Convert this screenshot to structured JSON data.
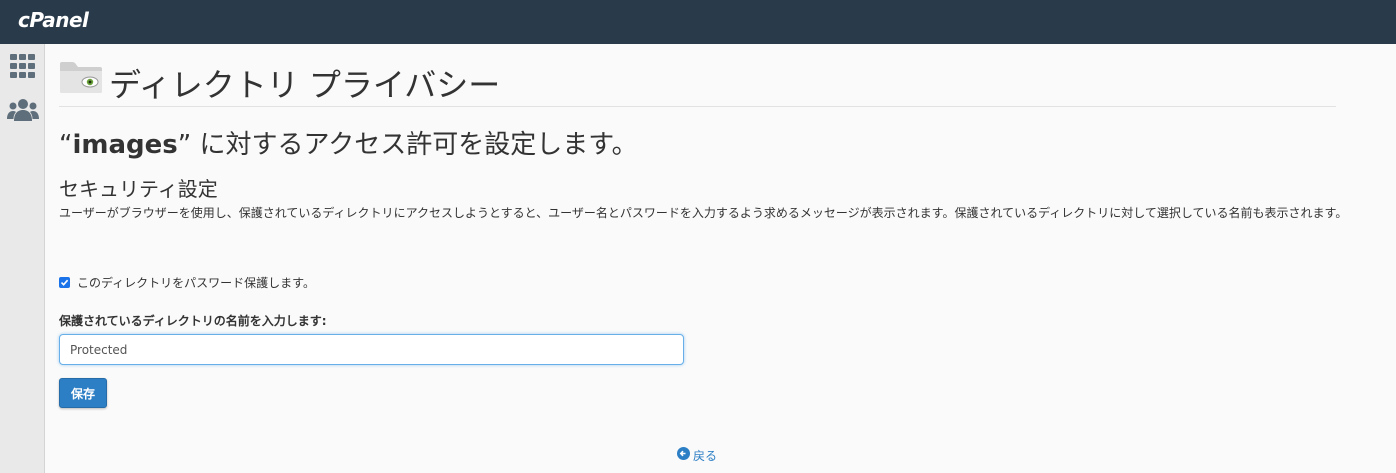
{
  "app": {
    "logo_text": "cPanel"
  },
  "header": {
    "title": "ディレクトリ プライバシー"
  },
  "subtitle": {
    "open_quote": "“",
    "directory": "images",
    "close_quote": "”",
    "text": " に対するアクセス許可を設定します。"
  },
  "security": {
    "title": "セキュリティ設定",
    "description": "ユーザーがブラウザーを使用し、保護されているディレクトリにアクセスしようとすると、ユーザー名とパスワードを入力するよう求めるメッセージが表示されます。保護されているディレクトリに対して選択している名前も表示されます。",
    "protect_label": "このディレクトリをパスワード保護します。",
    "protect_checked": true,
    "name_label": "保護されているディレクトリの名前を入力します:",
    "name_value": "Protected",
    "save_label": "保存"
  },
  "back": {
    "label": "戻る"
  },
  "colors": {
    "topbar": "#293a4a",
    "accent": "#2d7fc5",
    "checkbox": "#1a73e8"
  }
}
